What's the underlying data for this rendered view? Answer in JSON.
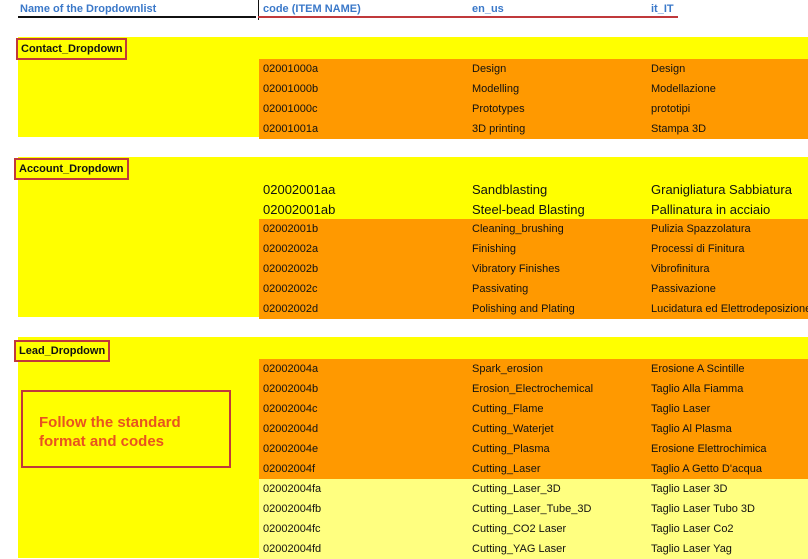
{
  "header": {
    "col_name": "Name of the Dropdownlist",
    "col_code": "code (ITEM NAME)",
    "col_en": "en_us",
    "col_it": "it_IT"
  },
  "sections": [
    {
      "title": "Contact_Dropdown",
      "rows": [
        {
          "code": "02001000a",
          "en": "Design",
          "it": "Design",
          "style": "orange"
        },
        {
          "code": "02001000b",
          "en": "Modelling",
          "it": "Modellazione",
          "style": "orange"
        },
        {
          "code": "02001000c",
          "en": "Prototypes",
          "it": "prototipi",
          "style": "orange"
        },
        {
          "code": "02001001a",
          "en": "3D printing",
          "it": "Stampa 3D",
          "style": "orange"
        }
      ]
    },
    {
      "title": "Account_Dropdown",
      "rows": [
        {
          "code": "02002001aa",
          "en": "Sandblasting",
          "it": "Granigliatura Sabbiatura",
          "style": "yellow"
        },
        {
          "code": "02002001ab",
          "en": "Steel-bead Blasting",
          "it": "Pallinatura in acciaio",
          "style": "yellow"
        },
        {
          "code": "02002001b",
          "en": "Cleaning_brushing",
          "it": "Pulizia Spazzolatura",
          "style": "orange"
        },
        {
          "code": "02002002a",
          "en": "Finishing",
          "it": "Processi di Finitura",
          "style": "orange"
        },
        {
          "code": "02002002b",
          "en": "Vibratory Finishes",
          "it": "Vibrofinitura",
          "style": "orange"
        },
        {
          "code": "02002002c",
          "en": "Passivating",
          "it": "Passivazione",
          "style": "orange"
        },
        {
          "code": "02002002d",
          "en": "Polishing and Plating",
          "it": "Lucidatura ed Elettrodeposizione",
          "style": "orange"
        }
      ]
    },
    {
      "title": "Lead_Dropdown",
      "rows": [
        {
          "code": "02002004a",
          "en": "Spark_erosion",
          "it": "Erosione A Scintille",
          "style": "orange"
        },
        {
          "code": "02002004b",
          "en": "Erosion_Electrochemical",
          "it": "Taglio Alla Fiamma",
          "style": "orange"
        },
        {
          "code": "02002004c",
          "en": "Cutting_Flame",
          "it": "Taglio Laser",
          "style": "orange"
        },
        {
          "code": "02002004d",
          "en": "Cutting_Waterjet",
          "it": "Taglio Al Plasma",
          "style": "orange"
        },
        {
          "code": "02002004e",
          "en": "Cutting_Plasma",
          "it": "Erosione Elettrochimica",
          "style": "orange"
        },
        {
          "code": "02002004f",
          "en": "Cutting_Laser",
          "it": "Taglio A Getto D'acqua",
          "style": "orange"
        },
        {
          "code": "02002004fa",
          "en": "Cutting_Laser_3D",
          "it": "Taglio Laser 3D",
          "style": "lightyellow"
        },
        {
          "code": "02002004fb",
          "en": "Cutting_Laser_Tube_3D",
          "it": "Taglio Laser Tubo 3D",
          "style": "lightyellow"
        },
        {
          "code": "02002004fc",
          "en": "Cutting_CO2 Laser",
          "it": "Taglio Laser Co2",
          "style": "lightyellow"
        },
        {
          "code": "02002004fd",
          "en": "Cutting_YAG Laser",
          "it": "Taglio Laser Yag",
          "style": "lightyellow"
        }
      ]
    }
  ],
  "note": {
    "line1": "Follow the standard",
    "line2": "format and codes"
  },
  "colors": {
    "yellow": "#ffff00",
    "orange": "#ff9900",
    "lightyellow": "#ffff80",
    "highlight_border": "#c0393b",
    "header_text": "#3a78c9",
    "note_text": "#e8531f"
  }
}
